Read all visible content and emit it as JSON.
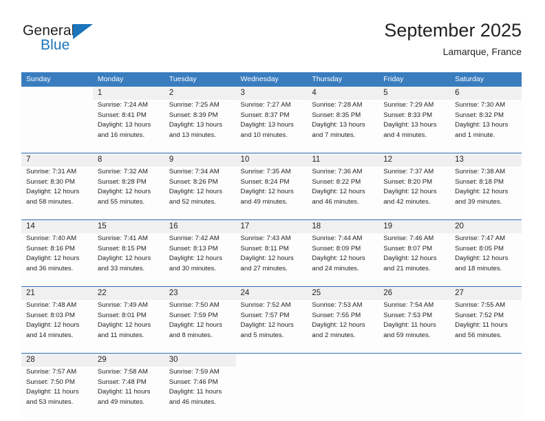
{
  "brand": {
    "name_part1": "General",
    "name_part2": "Blue"
  },
  "header": {
    "title": "September 2025",
    "location": "Lamarque, France"
  },
  "colors": {
    "header_blue": "#3a7dbf",
    "separator_blue": "#2f6fb0",
    "daynum_background": "#f0f0f0",
    "brand_blue": "#1b75bb",
    "text": "#231f20"
  },
  "weekdays": [
    "Sunday",
    "Monday",
    "Tuesday",
    "Wednesday",
    "Thursday",
    "Friday",
    "Saturday"
  ],
  "weeks": [
    {
      "days": [
        {
          "num": "",
          "lines": [
            "",
            "",
            "",
            ""
          ],
          "empty": true
        },
        {
          "num": "1",
          "lines": [
            "Sunrise: 7:24 AM",
            "Sunset: 8:41 PM",
            "Daylight: 13 hours",
            "and 16 minutes."
          ]
        },
        {
          "num": "2",
          "lines": [
            "Sunrise: 7:25 AM",
            "Sunset: 8:39 PM",
            "Daylight: 13 hours",
            "and 13 minutes."
          ]
        },
        {
          "num": "3",
          "lines": [
            "Sunrise: 7:27 AM",
            "Sunset: 8:37 PM",
            "Daylight: 13 hours",
            "and 10 minutes."
          ]
        },
        {
          "num": "4",
          "lines": [
            "Sunrise: 7:28 AM",
            "Sunset: 8:35 PM",
            "Daylight: 13 hours",
            "and 7 minutes."
          ]
        },
        {
          "num": "5",
          "lines": [
            "Sunrise: 7:29 AM",
            "Sunset: 8:33 PM",
            "Daylight: 13 hours",
            "and 4 minutes."
          ]
        },
        {
          "num": "6",
          "lines": [
            "Sunrise: 7:30 AM",
            "Sunset: 8:32 PM",
            "Daylight: 13 hours",
            "and 1 minute."
          ]
        }
      ]
    },
    {
      "days": [
        {
          "num": "7",
          "lines": [
            "Sunrise: 7:31 AM",
            "Sunset: 8:30 PM",
            "Daylight: 12 hours",
            "and 58 minutes."
          ]
        },
        {
          "num": "8",
          "lines": [
            "Sunrise: 7:32 AM",
            "Sunset: 8:28 PM",
            "Daylight: 12 hours",
            "and 55 minutes."
          ]
        },
        {
          "num": "9",
          "lines": [
            "Sunrise: 7:34 AM",
            "Sunset: 8:26 PM",
            "Daylight: 12 hours",
            "and 52 minutes."
          ]
        },
        {
          "num": "10",
          "lines": [
            "Sunrise: 7:35 AM",
            "Sunset: 8:24 PM",
            "Daylight: 12 hours",
            "and 49 minutes."
          ]
        },
        {
          "num": "11",
          "lines": [
            "Sunrise: 7:36 AM",
            "Sunset: 8:22 PM",
            "Daylight: 12 hours",
            "and 46 minutes."
          ]
        },
        {
          "num": "12",
          "lines": [
            "Sunrise: 7:37 AM",
            "Sunset: 8:20 PM",
            "Daylight: 12 hours",
            "and 42 minutes."
          ]
        },
        {
          "num": "13",
          "lines": [
            "Sunrise: 7:38 AM",
            "Sunset: 8:18 PM",
            "Daylight: 12 hours",
            "and 39 minutes."
          ]
        }
      ]
    },
    {
      "days": [
        {
          "num": "14",
          "lines": [
            "Sunrise: 7:40 AM",
            "Sunset: 8:16 PM",
            "Daylight: 12 hours",
            "and 36 minutes."
          ]
        },
        {
          "num": "15",
          "lines": [
            "Sunrise: 7:41 AM",
            "Sunset: 8:15 PM",
            "Daylight: 12 hours",
            "and 33 minutes."
          ]
        },
        {
          "num": "16",
          "lines": [
            "Sunrise: 7:42 AM",
            "Sunset: 8:13 PM",
            "Daylight: 12 hours",
            "and 30 minutes."
          ]
        },
        {
          "num": "17",
          "lines": [
            "Sunrise: 7:43 AM",
            "Sunset: 8:11 PM",
            "Daylight: 12 hours",
            "and 27 minutes."
          ]
        },
        {
          "num": "18",
          "lines": [
            "Sunrise: 7:44 AM",
            "Sunset: 8:09 PM",
            "Daylight: 12 hours",
            "and 24 minutes."
          ]
        },
        {
          "num": "19",
          "lines": [
            "Sunrise: 7:46 AM",
            "Sunset: 8:07 PM",
            "Daylight: 12 hours",
            "and 21 minutes."
          ]
        },
        {
          "num": "20",
          "lines": [
            "Sunrise: 7:47 AM",
            "Sunset: 8:05 PM",
            "Daylight: 12 hours",
            "and 18 minutes."
          ]
        }
      ]
    },
    {
      "days": [
        {
          "num": "21",
          "lines": [
            "Sunrise: 7:48 AM",
            "Sunset: 8:03 PM",
            "Daylight: 12 hours",
            "and 14 minutes."
          ]
        },
        {
          "num": "22",
          "lines": [
            "Sunrise: 7:49 AM",
            "Sunset: 8:01 PM",
            "Daylight: 12 hours",
            "and 11 minutes."
          ]
        },
        {
          "num": "23",
          "lines": [
            "Sunrise: 7:50 AM",
            "Sunset: 7:59 PM",
            "Daylight: 12 hours",
            "and 8 minutes."
          ]
        },
        {
          "num": "24",
          "lines": [
            "Sunrise: 7:52 AM",
            "Sunset: 7:57 PM",
            "Daylight: 12 hours",
            "and 5 minutes."
          ]
        },
        {
          "num": "25",
          "lines": [
            "Sunrise: 7:53 AM",
            "Sunset: 7:55 PM",
            "Daylight: 12 hours",
            "and 2 minutes."
          ]
        },
        {
          "num": "26",
          "lines": [
            "Sunrise: 7:54 AM",
            "Sunset: 7:53 PM",
            "Daylight: 11 hours",
            "and 59 minutes."
          ]
        },
        {
          "num": "27",
          "lines": [
            "Sunrise: 7:55 AM",
            "Sunset: 7:52 PM",
            "Daylight: 11 hours",
            "and 56 minutes."
          ]
        }
      ]
    },
    {
      "days": [
        {
          "num": "28",
          "lines": [
            "Sunrise: 7:57 AM",
            "Sunset: 7:50 PM",
            "Daylight: 11 hours",
            "and 53 minutes."
          ]
        },
        {
          "num": "29",
          "lines": [
            "Sunrise: 7:58 AM",
            "Sunset: 7:48 PM",
            "Daylight: 11 hours",
            "and 49 minutes."
          ]
        },
        {
          "num": "30",
          "lines": [
            "Sunrise: 7:59 AM",
            "Sunset: 7:46 PM",
            "Daylight: 11 hours",
            "and 46 minutes."
          ]
        },
        {
          "num": "",
          "lines": [
            "",
            "",
            "",
            ""
          ],
          "empty": true
        },
        {
          "num": "",
          "lines": [
            "",
            "",
            "",
            ""
          ],
          "empty": true
        },
        {
          "num": "",
          "lines": [
            "",
            "",
            "",
            ""
          ],
          "empty": true
        },
        {
          "num": "",
          "lines": [
            "",
            "",
            "",
            ""
          ],
          "empty": true
        }
      ]
    }
  ]
}
